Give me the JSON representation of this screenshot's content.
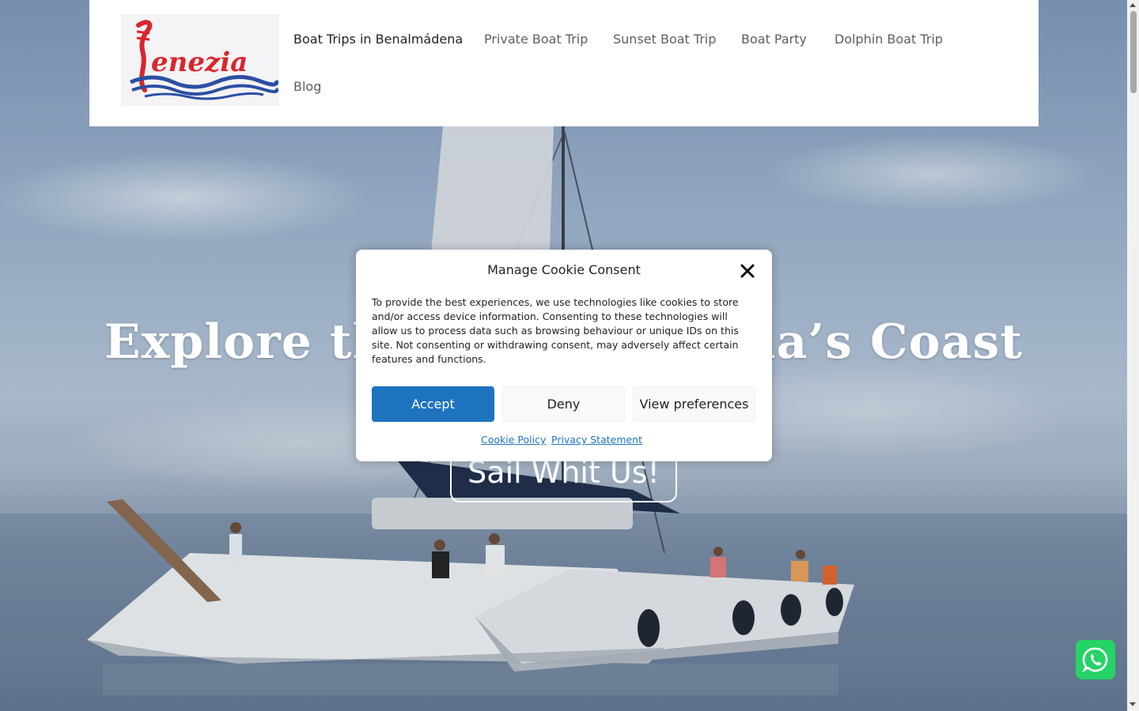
{
  "header": {
    "logo_text": "Venezia",
    "nav_items": [
      {
        "label": "Boat Trips in Benalmádena",
        "active": true
      },
      {
        "label": "Private Boat Trip",
        "active": false
      },
      {
        "label": "Sunset Boat Trip",
        "active": false
      },
      {
        "label": "Boat Party",
        "active": false
      },
      {
        "label": "Dolphin Boat Trip",
        "active": false
      },
      {
        "label": "Blog",
        "active": false
      }
    ]
  },
  "hero": {
    "title_visible": "Explore the Benalmádena’s Coast",
    "cta_label": "Sail Whit Us!"
  },
  "cookie_modal": {
    "title": "Manage Cookie Consent",
    "text": "To provide the best experiences, we use technologies like cookies to store and/or access device information. Consenting to these technologies will allow us to process data such as browsing behaviour or unique IDs on this site. Not consenting or withdrawing consent, may adversely affect certain features and functions.",
    "accept_label": "Accept",
    "deny_label": "Deny",
    "preferences_label": "View preferences",
    "cookie_policy_link": "Cookie Policy",
    "privacy_link": "Privacy Statement"
  },
  "colors": {
    "accent": "#1e73be",
    "logo_red": "#d8262e",
    "logo_blue": "#2b4fa2",
    "whatsapp": "#25d366"
  },
  "icons": [
    "close-icon",
    "whatsapp-icon",
    "logo-gondola-icon"
  ]
}
